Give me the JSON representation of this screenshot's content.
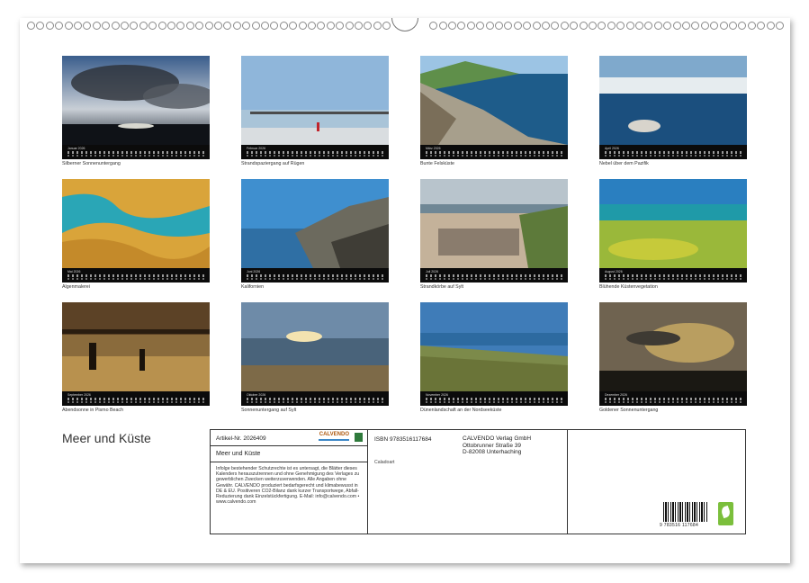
{
  "calendar_title": "Meer und Küste",
  "months": [
    {
      "name": "Januar 2026",
      "caption": "Silberner Sonnenuntergang"
    },
    {
      "name": "Februar 2026",
      "caption": "Strandspaziergang auf Rügen"
    },
    {
      "name": "März 2026",
      "caption": "Bunte Felsküste"
    },
    {
      "name": "April 2026",
      "caption": "Nebel über dem Pazifik"
    },
    {
      "name": "Mai 2026",
      "caption": "Algenmalerei"
    },
    {
      "name": "Juni 2026",
      "caption": "Kalifornien"
    },
    {
      "name": "Juli 2026",
      "caption": "Strandkörbe auf Sylt"
    },
    {
      "name": "August 2026",
      "caption": "Blühende Küstenvegetation"
    },
    {
      "name": "September 2026",
      "caption": "Abendsonne in Pismo Beach"
    },
    {
      "name": "Oktober 2026",
      "caption": "Sonnenuntergang auf Sylt"
    },
    {
      "name": "November 2026",
      "caption": "Dünenlandschaft an der Nordseeküste"
    },
    {
      "name": "Dezember 2026",
      "caption": "Goldener Sonnenuntergang"
    }
  ],
  "info": {
    "article": "Artikel-Nr. 2026409",
    "brand": "CALVENDO",
    "title": "Meer und Küste",
    "legal": "Infolge bestehender Schutzrechte ist es untersagt, die Blätter dieses Kalenders herauszutrennen und ohne Genehmigung des Verlages zu gewerblichen Zwecken weiterzuverwenden. Alle Angaben ohne Gewähr. CALVENDO produziert bedarfsgerecht und klimabewusst in DE & EU. Positiveren CO2-Bilanz dank kurzer Transportwege, Abfall-Reduzierung dank Einzelstückfertigung. E-Mail: info@calvendo.com • www.calvendo.com",
    "isbn": "ISBN 9783516117684",
    "publisher_lines": [
      "CALVENDO Verlag GmbH",
      "Ottobrunner Straße 39",
      "D-82008 Unterhaching"
    ],
    "catalog": "Caladoart",
    "barcode_number": "9 783516 117684"
  }
}
